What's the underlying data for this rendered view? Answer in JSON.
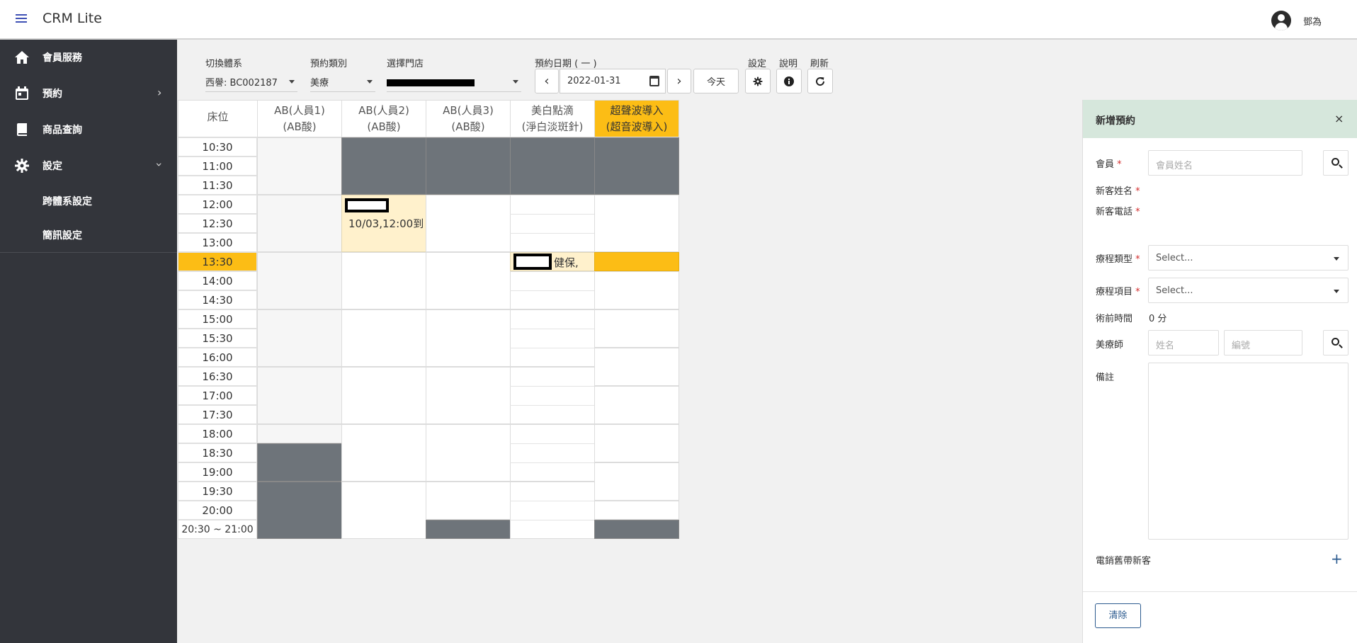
{
  "app": {
    "title": "CRM Lite",
    "user_name": "鄧為"
  },
  "sidebar": {
    "items": [
      {
        "label": "會員服務",
        "icon": "home-icon"
      },
      {
        "label": "預約",
        "icon": "calendar-icon"
      },
      {
        "label": "商品查詢",
        "icon": "book-icon"
      },
      {
        "label": "設定",
        "icon": "gear-icon"
      }
    ],
    "sub_items": [
      {
        "label": "跨體系設定"
      },
      {
        "label": "簡訊設定"
      }
    ]
  },
  "toolbar": {
    "system_label": "切換體系",
    "system_value": "西譽: BC002187",
    "type_label": "預約類別",
    "type_value": "美療",
    "store_label": "選擇門店",
    "date_label": "預約日期 ( 一 )",
    "date_value": "2022-01-31",
    "today_label": "今天",
    "settings_label": "設定",
    "help_label": "說明",
    "refresh_label": "刷新",
    "prev_glyph": "‹",
    "next_glyph": "›"
  },
  "schedule": {
    "bed_header": "床位",
    "columns": [
      {
        "line1": "AB(人員1)",
        "line2": "(AB酸)"
      },
      {
        "line1": "AB(人員2)",
        "line2": "(AB酸)"
      },
      {
        "line1": "AB(人員3)",
        "line2": "(AB酸)"
      },
      {
        "line1": "美白點滴",
        "line2": "(淨白淡斑針)"
      },
      {
        "line1": "超聲波導入",
        "line2": "(超音波導入)"
      }
    ],
    "times": [
      "10:30",
      "11:00",
      "11:30",
      "12:00",
      "12:30",
      "13:00",
      "13:30",
      "14:00",
      "14:30",
      "15:00",
      "15:30",
      "16:00",
      "16:30",
      "17:00",
      "17:30",
      "18:00",
      "18:30",
      "19:00",
      "19:30",
      "20:00",
      "20:30 ~ 21:00"
    ],
    "appointment_1": "10/03,12:00到",
    "appointment_2": "健保,"
  },
  "panel": {
    "title": "新增預約",
    "close_glyph": "×",
    "member_label": "會員",
    "member_placeholder": "會員姓名",
    "new_name_label": "新客姓名",
    "new_phone_label": "新客電話",
    "treatment_type_label": "療程類型",
    "treatment_item_label": "療程項目",
    "select_placeholder": "Select...",
    "pre_time_label": "術前時間",
    "pre_time_value": "0 分",
    "therapist_label": "美療師",
    "therapist_name_placeholder": "姓名",
    "therapist_id_placeholder": "編號",
    "note_label": "備註",
    "referral_label": "電銷舊帶新客",
    "plus_glyph": "+",
    "clear_label": "清除",
    "required_mark": "*"
  }
}
